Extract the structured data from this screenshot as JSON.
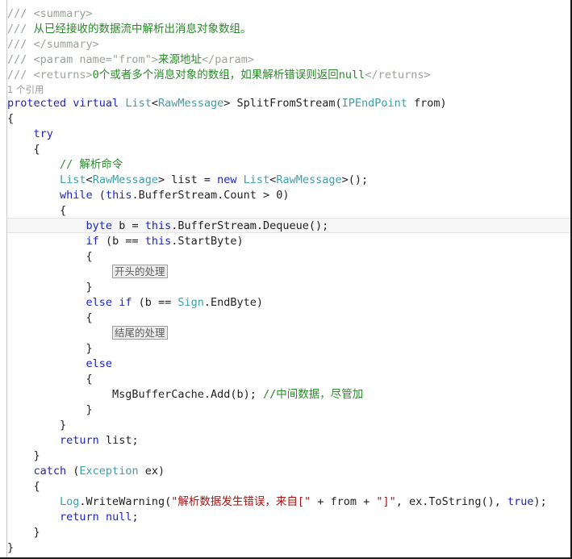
{
  "editor": {
    "language": "csharp",
    "colors": {
      "background": "#ffffff",
      "text": "#1f1f1f",
      "keyword": "#1b25c4",
      "type": "#3f9fa8",
      "comment": "#2a8a2a",
      "comment_slashes": "#9aa39a",
      "xml_doc_tag": "#9aa39a",
      "string": "#a31515",
      "codelens": "#9a9a9a",
      "current_line_fill": "#f6f6f6",
      "current_line_border": "#e4e4e4",
      "placeholder_box_border": "#9d9d9d",
      "placeholder_box_fill": "#ececec",
      "gutter_border": "#c9c9c9"
    },
    "codelens": {
      "reference_count": "1 个引用"
    },
    "placeholders": {
      "start_handling": "开头的处理",
      "end_handling": "结尾的处理"
    },
    "lines": [
      {
        "id": "doc-summary-open",
        "indent": 0,
        "tokens": [
          {
            "t": "cmt-slash",
            "v": "/// "
          },
          {
            "t": "xmltag",
            "v": "<summary>"
          }
        ]
      },
      {
        "id": "doc-summary-text",
        "indent": 0,
        "tokens": [
          {
            "t": "cmt-slash",
            "v": "/// "
          },
          {
            "t": "cmt",
            "v": "从已经接收的数据流中解析出消息对象数组。"
          }
        ]
      },
      {
        "id": "doc-summary-close",
        "indent": 0,
        "tokens": [
          {
            "t": "cmt-slash",
            "v": "/// "
          },
          {
            "t": "xmltag",
            "v": "</summary>"
          }
        ]
      },
      {
        "id": "doc-param-from",
        "indent": 0,
        "tokens": [
          {
            "t": "cmt-slash",
            "v": "/// "
          },
          {
            "t": "xmltag",
            "v": "<param name=\"from\">"
          },
          {
            "t": "cmt",
            "v": "来源地址"
          },
          {
            "t": "xmltag",
            "v": "</param>"
          }
        ]
      },
      {
        "id": "doc-returns",
        "indent": 0,
        "tokens": [
          {
            "t": "cmt-slash",
            "v": "/// "
          },
          {
            "t": "xmltag",
            "v": "<returns>"
          },
          {
            "t": "cmt",
            "v": "0个或者多个消息对象的数组，如果解析错误则返回null"
          },
          {
            "t": "xmltag",
            "v": "</returns>"
          }
        ]
      },
      {
        "id": "codelens-references",
        "codelens": true,
        "indent": 0,
        "text": "1 个引用"
      },
      {
        "id": "method-signature",
        "indent": 0,
        "tokens": [
          {
            "t": "kw",
            "v": "protected"
          },
          {
            "t": "plain",
            "v": " "
          },
          {
            "t": "kw",
            "v": "virtual"
          },
          {
            "t": "plain",
            "v": " "
          },
          {
            "t": "type",
            "v": "List"
          },
          {
            "t": "plain",
            "v": "<"
          },
          {
            "t": "type",
            "v": "RawMessage"
          },
          {
            "t": "plain",
            "v": "> SplitFromStream("
          },
          {
            "t": "type",
            "v": "IPEndPoint"
          },
          {
            "t": "plain",
            "v": " from)"
          }
        ]
      },
      {
        "id": "method-open-brace",
        "indent": 0,
        "tokens": [
          {
            "t": "plain",
            "v": "{"
          }
        ]
      },
      {
        "id": "try-keyword",
        "indent": 1,
        "tokens": [
          {
            "t": "kw",
            "v": "try"
          }
        ]
      },
      {
        "id": "try-open-brace",
        "indent": 1,
        "tokens": [
          {
            "t": "plain",
            "v": "{"
          }
        ]
      },
      {
        "id": "comment-parse-command",
        "indent": 2,
        "tokens": [
          {
            "t": "cmt",
            "v": "// 解析命令"
          }
        ]
      },
      {
        "id": "declare-list",
        "indent": 2,
        "tokens": [
          {
            "t": "type",
            "v": "List"
          },
          {
            "t": "plain",
            "v": "<"
          },
          {
            "t": "type",
            "v": "RawMessage"
          },
          {
            "t": "plain",
            "v": "> list = "
          },
          {
            "t": "kw",
            "v": "new"
          },
          {
            "t": "plain",
            "v": " "
          },
          {
            "t": "type",
            "v": "List"
          },
          {
            "t": "plain",
            "v": "<"
          },
          {
            "t": "type",
            "v": "RawMessage"
          },
          {
            "t": "plain",
            "v": ">();"
          }
        ]
      },
      {
        "id": "while-loop",
        "indent": 2,
        "tokens": [
          {
            "t": "kw",
            "v": "while"
          },
          {
            "t": "plain",
            "v": " ("
          },
          {
            "t": "kw",
            "v": "this"
          },
          {
            "t": "plain",
            "v": ".BufferStream.Count > 0)"
          }
        ]
      },
      {
        "id": "while-open-brace",
        "indent": 2,
        "tokens": [
          {
            "t": "plain",
            "v": "{"
          }
        ]
      },
      {
        "id": "dequeue-byte",
        "indent": 3,
        "current": true,
        "tokens": [
          {
            "t": "kw",
            "v": "byte"
          },
          {
            "t": "plain",
            "v": " b = "
          },
          {
            "t": "kw",
            "v": "this"
          },
          {
            "t": "plain",
            "v": ".BufferStream.Dequeue();"
          }
        ]
      },
      {
        "id": "if-startbyte",
        "indent": 3,
        "tokens": [
          {
            "t": "kw",
            "v": "if"
          },
          {
            "t": "plain",
            "v": " (b == "
          },
          {
            "t": "kw",
            "v": "this"
          },
          {
            "t": "plain",
            "v": ".StartByte)"
          }
        ]
      },
      {
        "id": "if-open-brace",
        "indent": 3,
        "tokens": [
          {
            "t": "plain",
            "v": "{"
          }
        ]
      },
      {
        "id": "placeholder-start",
        "indent": 4,
        "box": "开头的处理"
      },
      {
        "id": "if-close-brace",
        "indent": 3,
        "tokens": [
          {
            "t": "plain",
            "v": "}"
          }
        ]
      },
      {
        "id": "elseif-endbyte",
        "indent": 3,
        "tokens": [
          {
            "t": "kw",
            "v": "else"
          },
          {
            "t": "plain",
            "v": " "
          },
          {
            "t": "kw",
            "v": "if"
          },
          {
            "t": "plain",
            "v": " (b == "
          },
          {
            "t": "type",
            "v": "Sign"
          },
          {
            "t": "plain",
            "v": ".EndByte)"
          }
        ]
      },
      {
        "id": "elseif-open-brace",
        "indent": 3,
        "tokens": [
          {
            "t": "plain",
            "v": "{"
          }
        ]
      },
      {
        "id": "placeholder-end",
        "indent": 4,
        "box": "结尾的处理"
      },
      {
        "id": "elseif-close-brace",
        "indent": 3,
        "tokens": [
          {
            "t": "plain",
            "v": "}"
          }
        ]
      },
      {
        "id": "else-keyword",
        "indent": 3,
        "tokens": [
          {
            "t": "kw",
            "v": "else"
          }
        ]
      },
      {
        "id": "else-open-brace",
        "indent": 3,
        "tokens": [
          {
            "t": "plain",
            "v": "{"
          }
        ]
      },
      {
        "id": "msgbuffercache-add",
        "indent": 4,
        "tokens": [
          {
            "t": "plain",
            "v": "MsgBufferCache.Add(b); "
          },
          {
            "t": "cmt",
            "v": "//中间数据，尽管加"
          }
        ]
      },
      {
        "id": "else-close-brace",
        "indent": 3,
        "tokens": [
          {
            "t": "plain",
            "v": "}"
          }
        ]
      },
      {
        "id": "while-close-brace",
        "indent": 2,
        "tokens": [
          {
            "t": "plain",
            "v": "}"
          }
        ]
      },
      {
        "id": "return-list",
        "indent": 2,
        "tokens": [
          {
            "t": "kw",
            "v": "return"
          },
          {
            "t": "plain",
            "v": " list;"
          }
        ]
      },
      {
        "id": "try-close-brace",
        "indent": 1,
        "tokens": [
          {
            "t": "plain",
            "v": "}"
          }
        ]
      },
      {
        "id": "catch-clause",
        "indent": 1,
        "tokens": [
          {
            "t": "kw",
            "v": "catch"
          },
          {
            "t": "plain",
            "v": " ("
          },
          {
            "t": "type",
            "v": "Exception"
          },
          {
            "t": "plain",
            "v": " ex)"
          }
        ]
      },
      {
        "id": "catch-open-brace",
        "indent": 1,
        "tokens": [
          {
            "t": "plain",
            "v": "{"
          }
        ]
      },
      {
        "id": "log-writewarning",
        "indent": 2,
        "tokens": [
          {
            "t": "type",
            "v": "Log"
          },
          {
            "t": "plain",
            "v": ".WriteWarning("
          },
          {
            "t": "str",
            "v": "\"解析数据发生错误，来自[\""
          },
          {
            "t": "plain",
            "v": " + from + "
          },
          {
            "t": "str",
            "v": "\"]\""
          },
          {
            "t": "plain",
            "v": ", ex.ToString(), "
          },
          {
            "t": "kw",
            "v": "true"
          },
          {
            "t": "plain",
            "v": ");"
          }
        ]
      },
      {
        "id": "return-null",
        "indent": 2,
        "tokens": [
          {
            "t": "kw",
            "v": "return"
          },
          {
            "t": "plain",
            "v": " "
          },
          {
            "t": "kw",
            "v": "null"
          },
          {
            "t": "plain",
            "v": ";"
          }
        ]
      },
      {
        "id": "catch-close-brace",
        "indent": 1,
        "tokens": [
          {
            "t": "plain",
            "v": "}"
          }
        ]
      },
      {
        "id": "method-close-brace",
        "indent": 0,
        "tokens": [
          {
            "t": "plain",
            "v": "}"
          }
        ]
      }
    ]
  }
}
